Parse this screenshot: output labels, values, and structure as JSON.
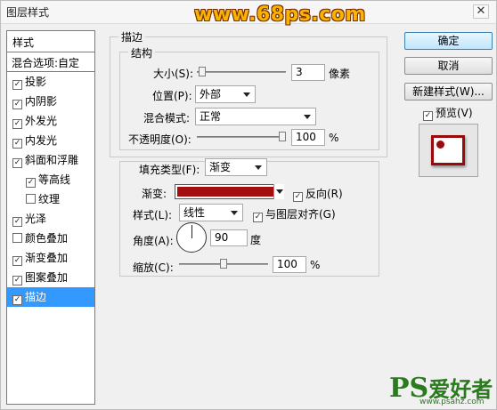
{
  "window": {
    "title": "图层样式",
    "watermark_top": "www.68ps.com",
    "close": "✕"
  },
  "sidebar": {
    "header": "样式",
    "blend_options": "混合选项:自定",
    "items": [
      {
        "label": "投影",
        "checked": true,
        "sub": false
      },
      {
        "label": "内阴影",
        "checked": true,
        "sub": false
      },
      {
        "label": "外发光",
        "checked": true,
        "sub": false
      },
      {
        "label": "内发光",
        "checked": true,
        "sub": false
      },
      {
        "label": "斜面和浮雕",
        "checked": true,
        "sub": false
      },
      {
        "label": "等高线",
        "checked": true,
        "sub": true
      },
      {
        "label": "纹理",
        "checked": false,
        "sub": true
      },
      {
        "label": "光泽",
        "checked": true,
        "sub": false
      },
      {
        "label": "颜色叠加",
        "checked": false,
        "sub": false
      },
      {
        "label": "渐变叠加",
        "checked": true,
        "sub": false
      },
      {
        "label": "图案叠加",
        "checked": true,
        "sub": false
      },
      {
        "label": "描边",
        "checked": true,
        "sub": false,
        "selected": true
      }
    ]
  },
  "stroke": {
    "section_title": "描边",
    "structure_title": "结构",
    "size_label": "大小(S):",
    "size_value": "3",
    "size_unit": "像素",
    "size_slider_fraction": 0.02,
    "position_label": "位置(P):",
    "position_value": "外部",
    "blend_label": "混合模式:",
    "blend_value": "正常",
    "opacity_label": "不透明度(O):",
    "opacity_value": "100",
    "opacity_unit": "%",
    "opacity_slider_fraction": 1.0
  },
  "fill": {
    "type_label": "填充类型(F):",
    "type_value": "渐变",
    "gradient_label": "渐变:",
    "gradient_color": "#a40e0e",
    "reverse_label": "反向(R)",
    "reverse_checked": true,
    "style_label": "样式(L):",
    "style_value": "线性",
    "align_label": "与图层对齐(G)",
    "align_checked": true,
    "angle_label": "角度(A):",
    "angle_value": "90",
    "angle_unit": "度",
    "scale_label": "缩放(C):",
    "scale_value": "100",
    "scale_unit": "%",
    "scale_slider_fraction": 0.5
  },
  "buttons": {
    "ok": "确定",
    "cancel": "取消",
    "new_style": "新建样式(W)...",
    "preview_label": "预览(V)",
    "preview_checked": true
  },
  "watermark_bottom": {
    "brand": "PS",
    "text": "爱好者",
    "url": "www.psahz.com"
  },
  "colors": {
    "accent": "#3399ff",
    "stroke": "#9b0a0a"
  }
}
